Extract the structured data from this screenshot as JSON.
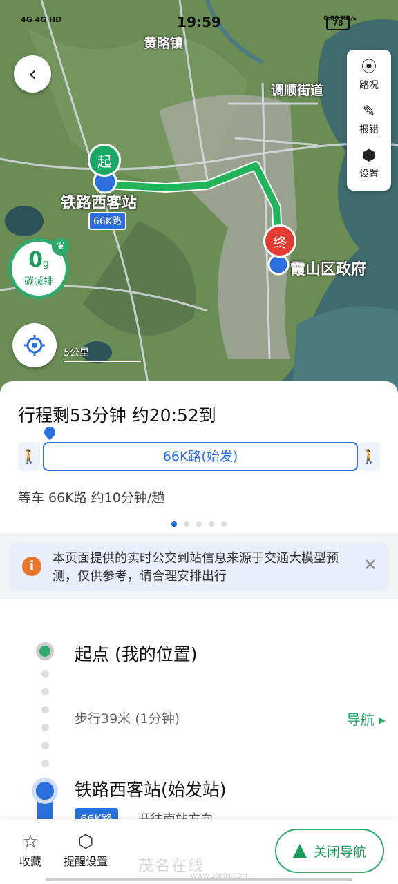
{
  "status": {
    "time": "19:59",
    "left": "4G  4G  HD",
    "right": "0.00 KB/s",
    "battery": "78"
  },
  "map": {
    "place_labels": {
      "top": "黄略镇",
      "right": "调顺街道"
    },
    "start_pin": "起",
    "end_pin": "终",
    "start_station": "铁路西客站",
    "route_tag": "66K路",
    "end_station": "霞山区政府",
    "scale": "5公里",
    "carbon": {
      "value": "0",
      "unit": "g",
      "label": "碳减排"
    }
  },
  "tools": {
    "traffic": "路况",
    "report": "报错",
    "settings": "设置"
  },
  "trip": {
    "summary": "行程剩53分钟 约20:52到",
    "bus_segment": "66K路(始发)",
    "wait": "等车 66K路 约10分钟/趟"
  },
  "notice": {
    "text": "本页面提供的实时公交到站信息来源于交通大模型预测，仅供参考，请合理安排出行"
  },
  "timeline": {
    "start": "起点 (我的位置)",
    "walk": "步行39米 (1分钟)",
    "nav": "导航",
    "station": "铁路西客站(始发站)",
    "chip": "66K路",
    "direction": "开往南站方向"
  },
  "bottom": {
    "favorite": "收藏",
    "remind": "提醒设置",
    "close_nav": "关闭导航"
  },
  "watermark": {
    "main": "茂名在线",
    "sub": "WWW.GDMM.COM"
  },
  "colors": {
    "accent_blue": "#2a6fdb",
    "accent_green": "#2fa96c",
    "end_red": "#e33b32"
  }
}
